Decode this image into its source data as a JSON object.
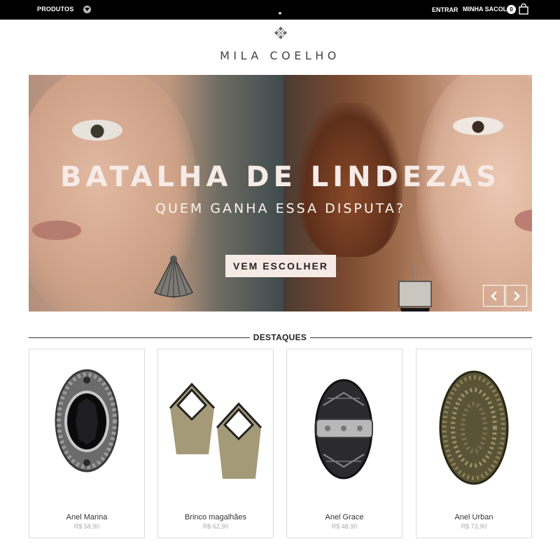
{
  "topbar": {
    "menu_label": "PRODUTOS",
    "login_label": "ENTRAR",
    "bag_label": "MINHA SACOLA",
    "bag_count": "0"
  },
  "brand": {
    "name": "MILA COELHO"
  },
  "hero": {
    "headline": "BATALHA DE LINDEZAS",
    "subline": "QUEM GANHA ESSA DISPUTA?",
    "cta_label": "VEM ESCOLHER"
  },
  "featured": {
    "title": "DESTAQUES",
    "products": [
      {
        "name": "Anel Marina",
        "price": "R$ 58,90"
      },
      {
        "name": "Brinco magalhães",
        "price": "R$ 62,90"
      },
      {
        "name": "Anel Grace",
        "price": "R$ 48,90"
      },
      {
        "name": "Anel Urban",
        "price": "R$ 73,90"
      }
    ]
  },
  "icons": [
    "chevron-down-icon",
    "heart-icon",
    "shopping-bag-icon",
    "logo-mark-icon",
    "chevron-left-icon",
    "chevron-right-icon"
  ],
  "colors": {
    "topbar_bg": "#000000",
    "cta_bg": "#f5ebe4",
    "text_dark": "#222222",
    "price_gray": "#aaaaaa"
  }
}
